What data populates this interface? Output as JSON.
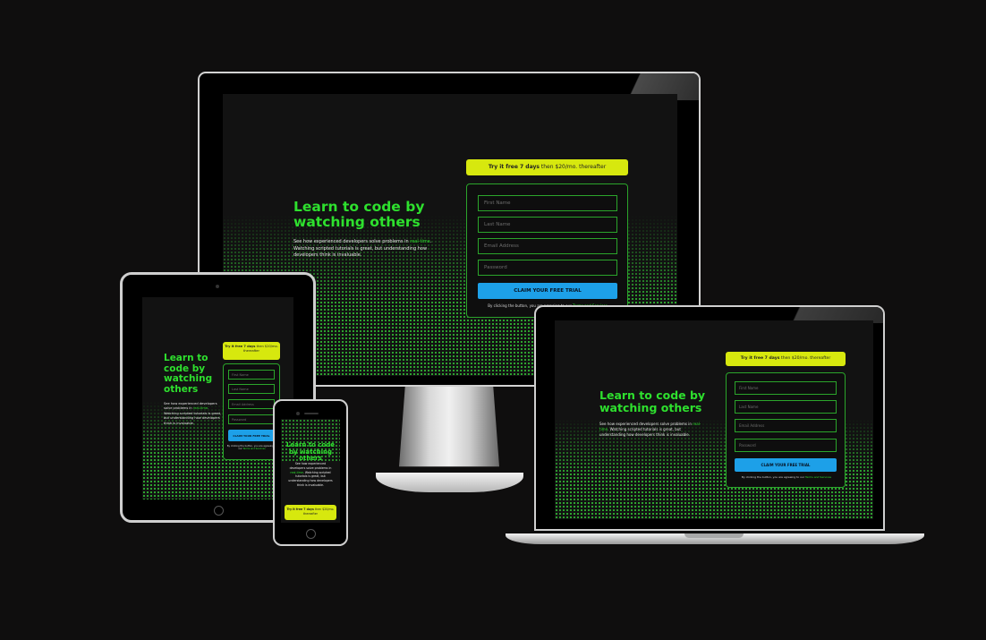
{
  "hero": {
    "heading": "Learn to code by watching others",
    "desc_before": "See how experienced developers solve problems in ",
    "desc_highlight": "real-time",
    "desc_after": ". Watching scripted tutorials is great, but understanding how developers think is invaluable."
  },
  "promo": {
    "bold": "Try it free 7 days",
    "rest": " then $20/mo. thereafter"
  },
  "form": {
    "first_name": "First Name",
    "last_name": "Last Name",
    "email": "Email Address",
    "password": "Password",
    "submit": "CLAIM YOUR FREE TRIAL",
    "terms_prefix": "By clicking the button, you are agreeing to our ",
    "terms_link": "Terms and Services"
  },
  "colors": {
    "background": "#0f0e0e",
    "accent_green": "#2ee02e",
    "promo_yellow": "#d7e80e",
    "cta_blue": "#1da0e8"
  },
  "devices": [
    "desktop-monitor",
    "tablet",
    "laptop",
    "phone"
  ]
}
